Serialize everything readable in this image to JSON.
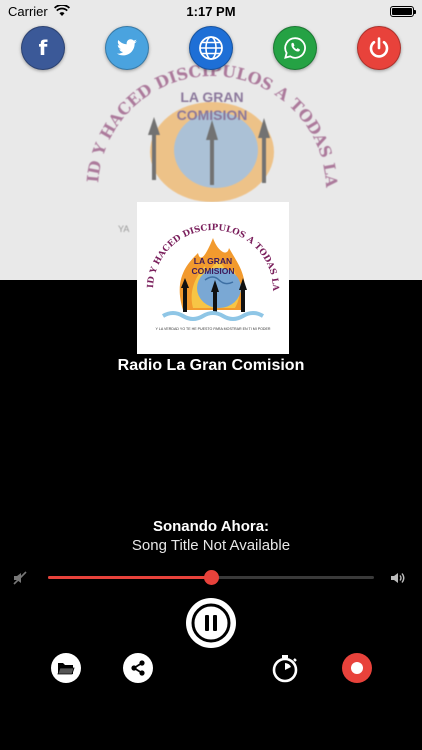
{
  "status_bar": {
    "carrier": "Carrier",
    "time": "1:17 PM"
  },
  "social": [
    {
      "name": "facebook",
      "label": "f",
      "color": "#3b5998"
    },
    {
      "name": "twitter",
      "color": "#4aa3df"
    },
    {
      "name": "website",
      "color": "#1e6fd6"
    },
    {
      "name": "whatsapp",
      "color": "#25a244"
    },
    {
      "name": "power",
      "color": "#e8423b"
    }
  ],
  "logo": {
    "arc_text": "ID Y HACED DISCIPULOS A TODAS LAS NACIONES",
    "brand_line1": "LA GRAN",
    "brand_line2": "COMISION",
    "tagline": "Y LA VERDAD YO TE HE PUESTO PARA MOSTRAR EN TI MI PODER"
  },
  "banner": {
    "caption": "YA"
  },
  "player": {
    "station_name": "Radio La Gran Comision",
    "now_playing_label": "Sonando Ahora:",
    "song_title": "Song Title Not Available",
    "volume": 0.5,
    "state": "playing"
  },
  "colors": {
    "accent": "#e8423b",
    "background": "#000000"
  }
}
